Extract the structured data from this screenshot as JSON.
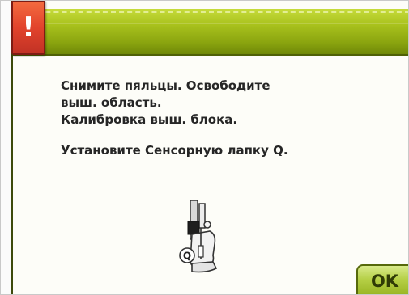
{
  "dialog": {
    "alert_symbol": "!",
    "message_lines": [
      "Снимите пяльцы. Освободите",
      "выш. область.",
      "Калибровка выш. блока."
    ],
    "instruction": "Установите Сенсорную лапку Q.",
    "foot_letter": "Q",
    "ok_label": "OK"
  },
  "icons": {
    "alert": "exclamation-warning-icon",
    "illustration": "sensor-presser-foot-q-icon"
  },
  "colors": {
    "titlebar": "#a9c21d",
    "alert_badge": "#e2432c",
    "ok_button": "#b5cf45",
    "text": "#262626"
  }
}
